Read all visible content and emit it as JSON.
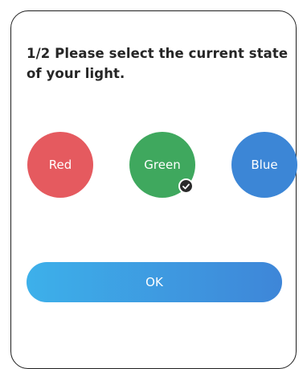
{
  "dialog": {
    "question": "1/2  Please select the current state of your light.",
    "options": [
      {
        "label": "Red",
        "color": "#e55a5f",
        "selected": false
      },
      {
        "label": "Green",
        "color": "#3fa85e",
        "selected": true
      },
      {
        "label": "Blue",
        "color": "#3c86d6",
        "selected": false
      }
    ],
    "ok_button": {
      "label": "OK",
      "gradient_start": "#3db0ea",
      "gradient_end": "#3e86d8"
    },
    "check_icon": "checkmark-icon"
  }
}
